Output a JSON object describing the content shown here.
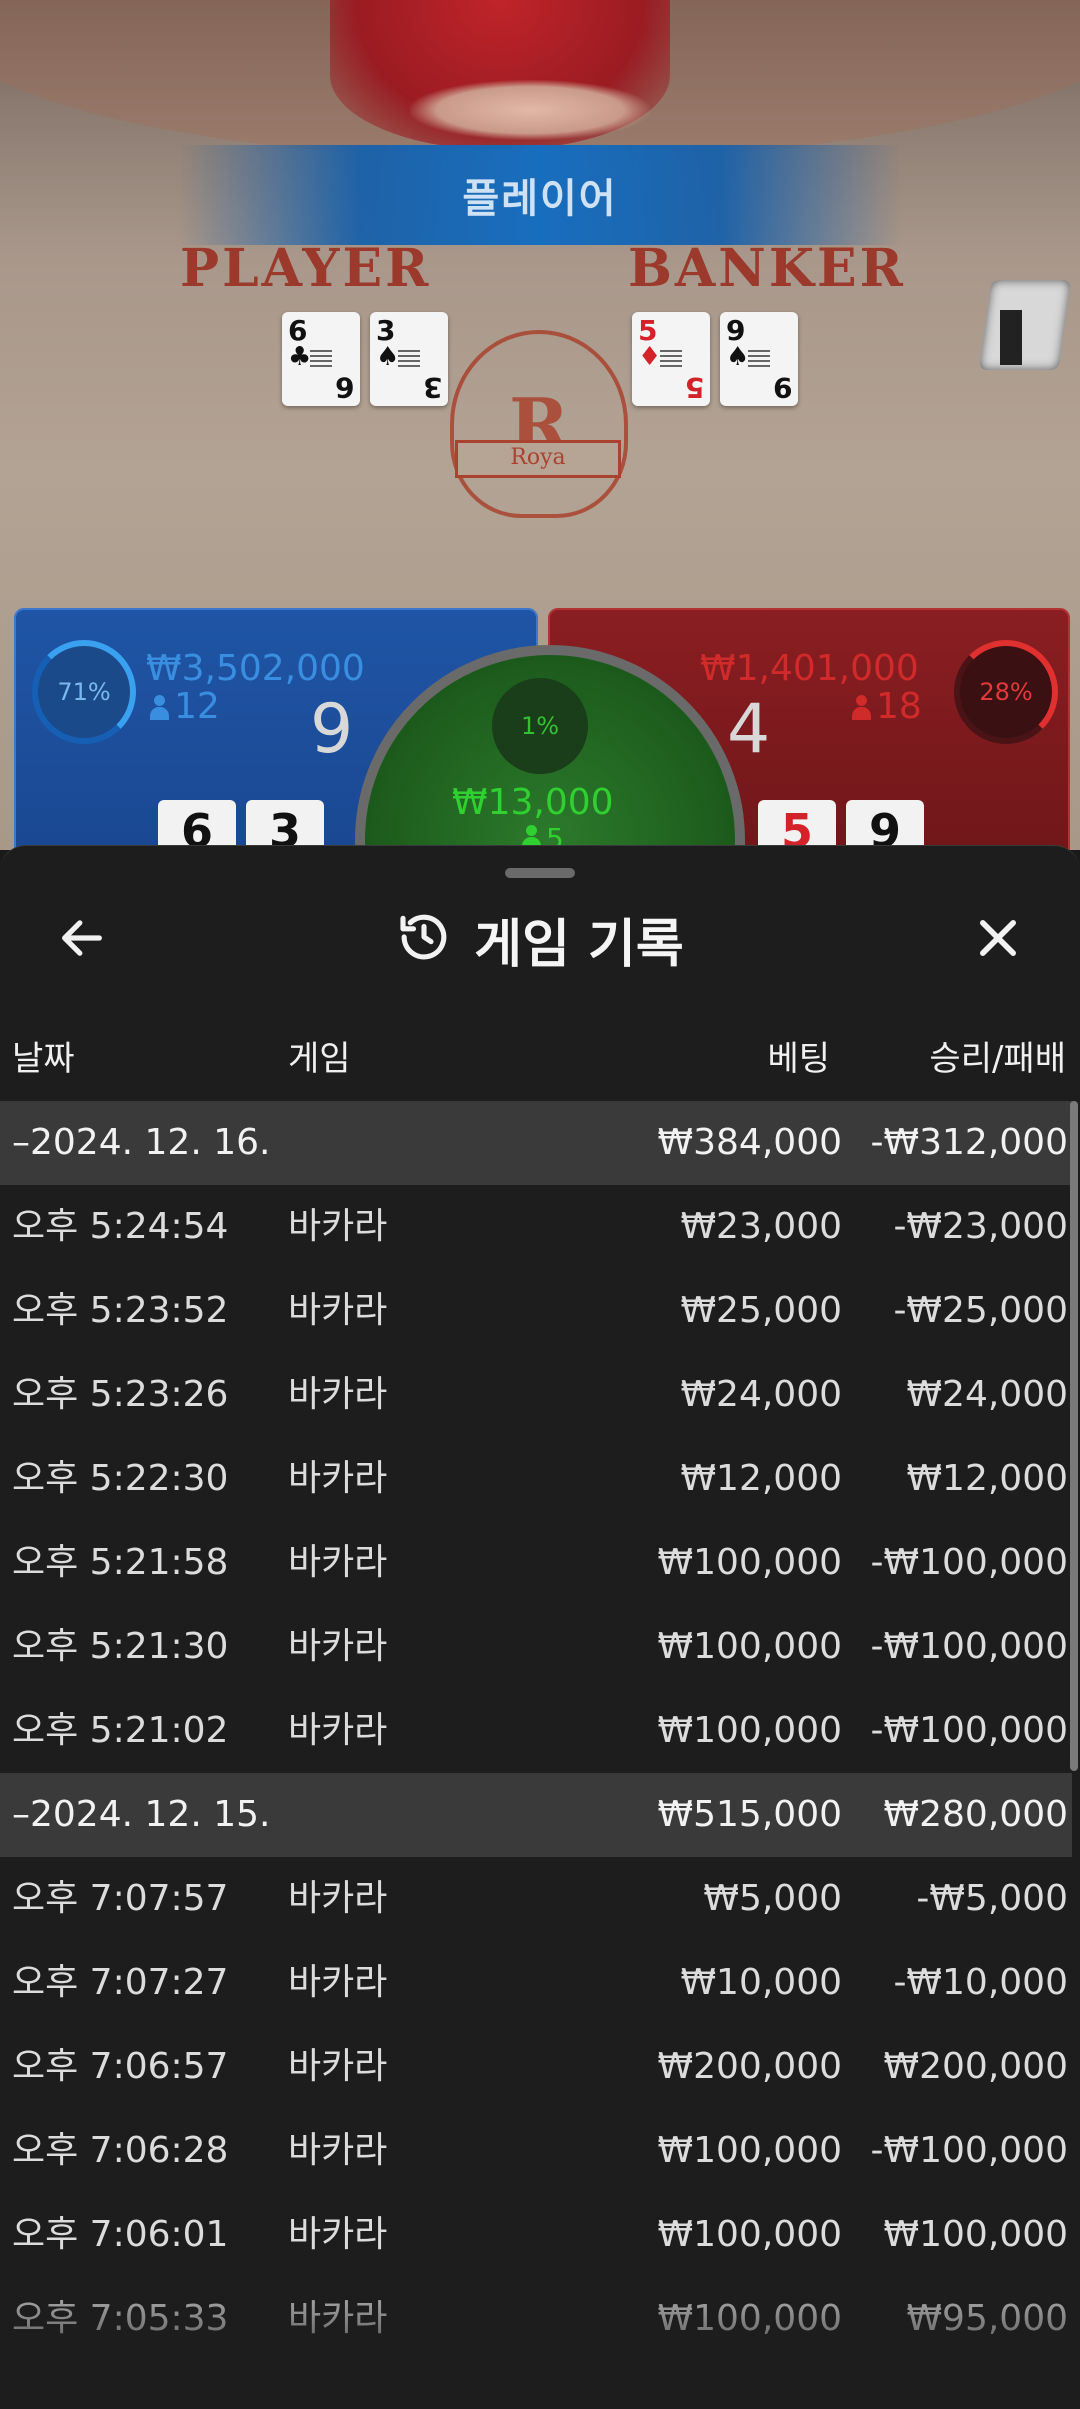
{
  "scene": {
    "result_banner": "플레이어",
    "player_title": "PLAYER",
    "banker_title": "BANKER",
    "crest_letter": "R",
    "crest_text": "Roya",
    "player_cards": [
      {
        "rank": "6",
        "suit": "♣",
        "color": "#111111"
      },
      {
        "rank": "3",
        "suit": "♠",
        "color": "#111111"
      }
    ],
    "banker_cards": [
      {
        "rank": "5",
        "suit": "♦",
        "color": "#d4222a"
      },
      {
        "rank": "9",
        "suit": "♠",
        "color": "#111111"
      }
    ],
    "player": {
      "percent": "71%",
      "amount": "₩3,502,000",
      "count": "12",
      "score": "9",
      "mini_cards": [
        "6",
        "3"
      ]
    },
    "banker": {
      "percent": "28%",
      "amount": "₩1,401,000",
      "count": "18",
      "score": "4",
      "mini_cards": [
        "5",
        "9"
      ]
    },
    "tie": {
      "percent": "1%",
      "amount": "₩13,000",
      "count": "5"
    }
  },
  "sheet": {
    "title": "게임 기록",
    "icons": {
      "back": "arrow-left-icon",
      "history": "history-icon",
      "close": "close-icon"
    },
    "columns": {
      "date": "날짜",
      "game": "게임",
      "bet": "베팅",
      "result": "승리/패배"
    },
    "groups": [
      {
        "date": "–2024. 12. 16.",
        "bet": "₩384,000",
        "result": "-₩312,000",
        "rows": [
          {
            "time": "오후 5:24:54",
            "game": "바카라",
            "bet": "₩23,000",
            "result": "-₩23,000"
          },
          {
            "time": "오후 5:23:52",
            "game": "바카라",
            "bet": "₩25,000",
            "result": "-₩25,000"
          },
          {
            "time": "오후 5:23:26",
            "game": "바카라",
            "bet": "₩24,000",
            "result": "₩24,000"
          },
          {
            "time": "오후 5:22:30",
            "game": "바카라",
            "bet": "₩12,000",
            "result": "₩12,000"
          },
          {
            "time": "오후 5:21:58",
            "game": "바카라",
            "bet": "₩100,000",
            "result": "-₩100,000"
          },
          {
            "time": "오후 5:21:30",
            "game": "바카라",
            "bet": "₩100,000",
            "result": "-₩100,000"
          },
          {
            "time": "오후 5:21:02",
            "game": "바카라",
            "bet": "₩100,000",
            "result": "-₩100,000"
          }
        ]
      },
      {
        "date": "–2024. 12. 15.",
        "bet": "₩515,000",
        "result": "₩280,000",
        "rows": [
          {
            "time": "오후 7:07:57",
            "game": "바카라",
            "bet": "₩5,000",
            "result": "-₩5,000"
          },
          {
            "time": "오후 7:07:27",
            "game": "바카라",
            "bet": "₩10,000",
            "result": "-₩10,000"
          },
          {
            "time": "오후 7:06:57",
            "game": "바카라",
            "bet": "₩200,000",
            "result": "₩200,000"
          },
          {
            "time": "오후 7:06:28",
            "game": "바카라",
            "bet": "₩100,000",
            "result": "-₩100,000"
          },
          {
            "time": "오후 7:06:01",
            "game": "바카라",
            "bet": "₩100,000",
            "result": "₩100,000"
          },
          {
            "time": "오후 7:05:33",
            "game": "바카라",
            "bet": "₩100,000",
            "result": "₩95,000"
          }
        ]
      }
    ]
  }
}
